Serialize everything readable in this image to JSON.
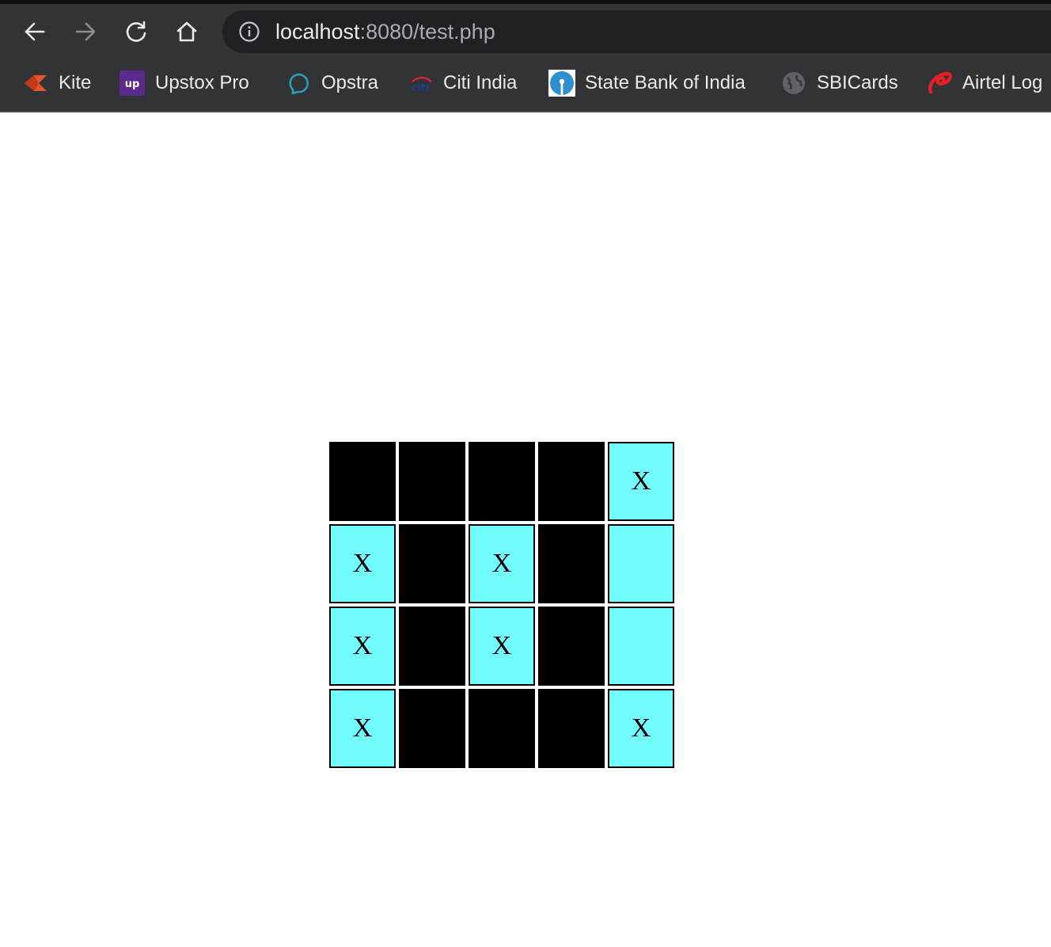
{
  "browser": {
    "url_host": "localhost",
    "url_rest": ":8080/test.php",
    "icons": {
      "back": "arrow-left-icon",
      "forward": "arrow-right-icon",
      "reload": "reload-icon",
      "home": "home-icon",
      "site_info": "info-icon"
    }
  },
  "bookmarks": [
    {
      "label": "Kite",
      "icon": "kite-icon",
      "color": "#e4542d"
    },
    {
      "label": "Upstox Pro",
      "icon": "upstox-icon",
      "color": "#5a2a8c",
      "icon_text": "up"
    },
    {
      "label": "Opstra",
      "icon": "opstra-icon",
      "color": "#2f9db5"
    },
    {
      "label": "Citi India",
      "icon": "citi-icon",
      "color": "#1a3e8c",
      "icon_text": "citi"
    },
    {
      "label": "State Bank of India",
      "icon": "sbi-icon",
      "color": "#2d8fcf"
    },
    {
      "label": "SBICards",
      "icon": "globe-icon",
      "color": "#5f6368"
    },
    {
      "label": "Airtel Log",
      "icon": "airtel-icon",
      "color": "#e41f25"
    }
  ],
  "board": {
    "colors": {
      "dark": "#000000",
      "lit": "#73fcfd"
    },
    "rows": [
      [
        {
          "state": "dark",
          "mark": ""
        },
        {
          "state": "dark",
          "mark": ""
        },
        {
          "state": "dark",
          "mark": ""
        },
        {
          "state": "dark",
          "mark": ""
        },
        {
          "state": "lit",
          "mark": "X"
        }
      ],
      [
        {
          "state": "lit",
          "mark": "X"
        },
        {
          "state": "dark",
          "mark": ""
        },
        {
          "state": "lit",
          "mark": "X"
        },
        {
          "state": "dark",
          "mark": ""
        },
        {
          "state": "lit",
          "mark": ""
        }
      ],
      [
        {
          "state": "lit",
          "mark": "X"
        },
        {
          "state": "dark",
          "mark": ""
        },
        {
          "state": "lit",
          "mark": "X"
        },
        {
          "state": "dark",
          "mark": ""
        },
        {
          "state": "lit",
          "mark": ""
        }
      ],
      [
        {
          "state": "lit",
          "mark": "X"
        },
        {
          "state": "dark",
          "mark": ""
        },
        {
          "state": "dark",
          "mark": ""
        },
        {
          "state": "dark",
          "mark": ""
        },
        {
          "state": "lit",
          "mark": "X"
        }
      ]
    ]
  }
}
